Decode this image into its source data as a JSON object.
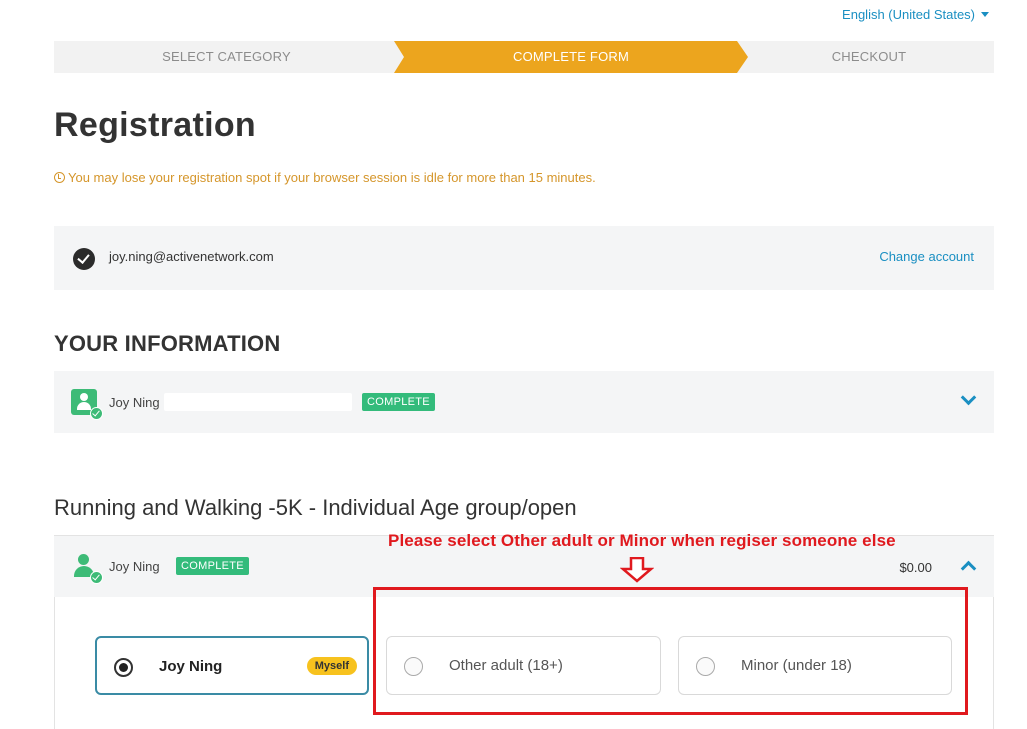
{
  "language": {
    "label": "English (United States)"
  },
  "steps": [
    {
      "label": "SELECT CATEGORY"
    },
    {
      "label": "COMPLETE FORM"
    },
    {
      "label": "CHECKOUT"
    }
  ],
  "page": {
    "title": "Registration",
    "warning": "You may lose your registration spot if your browser session is idle for more than 15 minutes."
  },
  "account": {
    "email": "joy.ning@activenetwork.com",
    "change_label": "Change account"
  },
  "your_information": {
    "heading": "YOUR INFORMATION",
    "participant_name": "Joy Ning",
    "status": "COMPLETE"
  },
  "event": {
    "heading": "Running and Walking -5K - Individual Age group/open",
    "participant_name": "Joy Ning",
    "status": "COMPLETE",
    "price": "$0.00",
    "options": [
      {
        "label": "Joy Ning",
        "tag": "Myself",
        "selected": true
      },
      {
        "label": "Other adult (18+)",
        "selected": false
      },
      {
        "label": "Minor (under 18)",
        "selected": false
      }
    ]
  },
  "annotation": {
    "text": "Please select Other adult or Minor when regiser someone else",
    "color": "#e0191e"
  },
  "colors": {
    "accent": "#1a8fc2",
    "active_step": "#eca51e",
    "complete_badge": "#33bb7b",
    "warning": "#d5962b"
  }
}
